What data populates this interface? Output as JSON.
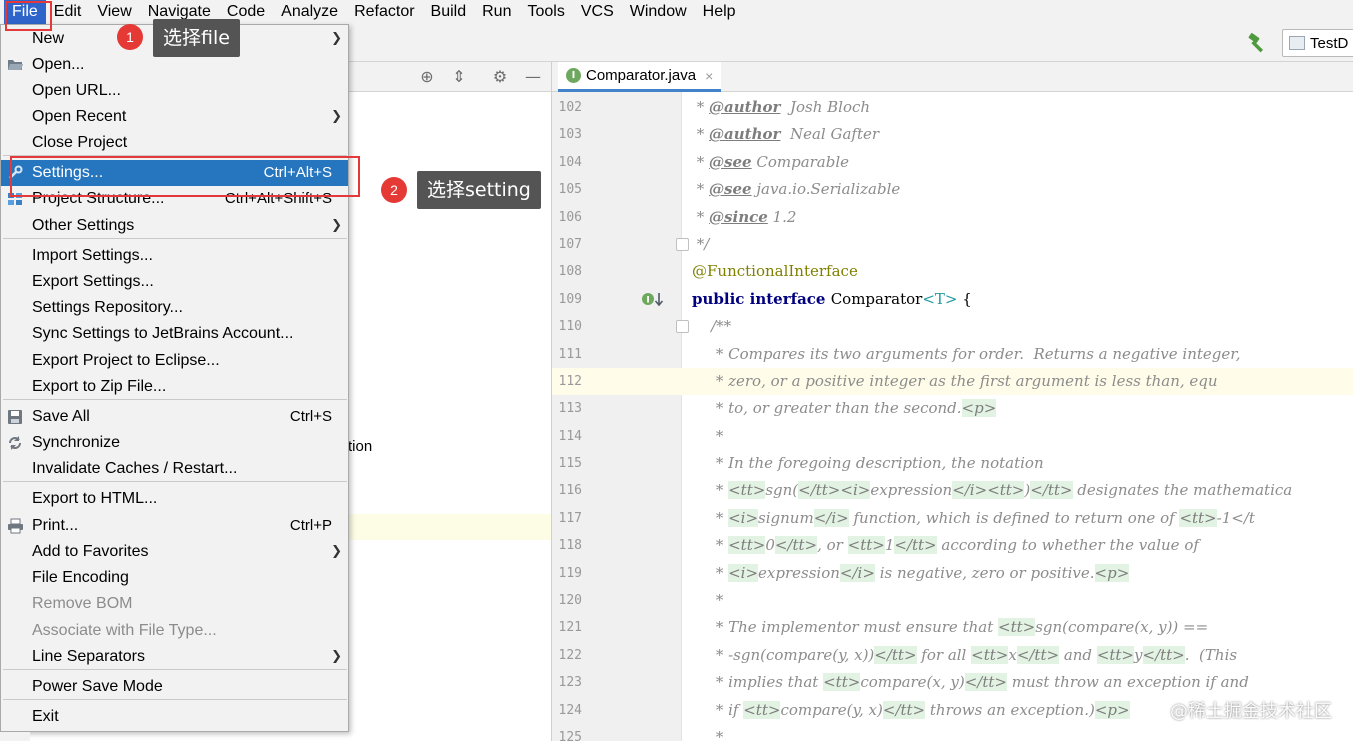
{
  "menubar": {
    "items": [
      "File",
      "Edit",
      "View",
      "Navigate",
      "Code",
      "Analyze",
      "Refactor",
      "Build",
      "Run",
      "Tools",
      "VCS",
      "Window",
      "Help"
    ]
  },
  "toolbar": {
    "run_config_label": "TestD"
  },
  "project_panel": {
    "partial_text": "tion"
  },
  "editor": {
    "tab_label": "Comparator.java",
    "tab_close": "×"
  },
  "file_menu": {
    "items": [
      {
        "label": "New",
        "shortcut": "",
        "submenu": true,
        "disabled": false
      },
      {
        "label": "Open...",
        "shortcut": "",
        "submenu": false,
        "disabled": false,
        "icon": "folder-open-icon"
      },
      {
        "label": "Open URL...",
        "shortcut": "",
        "submenu": false,
        "disabled": false
      },
      {
        "label": "Open Recent",
        "shortcut": "",
        "submenu": true,
        "disabled": false
      },
      {
        "label": "Close Project",
        "shortcut": "",
        "submenu": false,
        "disabled": false
      },
      {
        "label": "Settings...",
        "shortcut": "Ctrl+Alt+S",
        "submenu": false,
        "disabled": false,
        "selected": true,
        "icon": "wrench-icon"
      },
      {
        "label": "Project Structure...",
        "shortcut": "Ctrl+Alt+Shift+S",
        "submenu": false,
        "disabled": false,
        "icon": "project-structure-icon"
      },
      {
        "label": "Other Settings",
        "shortcut": "",
        "submenu": true,
        "disabled": false
      },
      {
        "label": "Import Settings...",
        "shortcut": "",
        "submenu": false,
        "disabled": false
      },
      {
        "label": "Export Settings...",
        "shortcut": "",
        "submenu": false,
        "disabled": false
      },
      {
        "label": "Settings Repository...",
        "shortcut": "",
        "submenu": false,
        "disabled": false
      },
      {
        "label": "Sync Settings to JetBrains Account...",
        "shortcut": "",
        "submenu": false,
        "disabled": false
      },
      {
        "label": "Export Project to Eclipse...",
        "shortcut": "",
        "submenu": false,
        "disabled": false
      },
      {
        "label": "Export to Zip File...",
        "shortcut": "",
        "submenu": false,
        "disabled": false
      },
      {
        "label": "Save All",
        "shortcut": "Ctrl+S",
        "submenu": false,
        "disabled": false,
        "icon": "save-icon"
      },
      {
        "label": "Synchronize",
        "shortcut": "",
        "submenu": false,
        "disabled": false,
        "icon": "sync-icon"
      },
      {
        "label": "Invalidate Caches / Restart...",
        "shortcut": "",
        "submenu": false,
        "disabled": false
      },
      {
        "label": "Export to HTML...",
        "shortcut": "",
        "submenu": false,
        "disabled": false
      },
      {
        "label": "Print...",
        "shortcut": "Ctrl+P",
        "submenu": false,
        "disabled": false,
        "icon": "print-icon"
      },
      {
        "label": "Add to Favorites",
        "shortcut": "",
        "submenu": true,
        "disabled": false
      },
      {
        "label": "File Encoding",
        "shortcut": "",
        "submenu": false,
        "disabled": false
      },
      {
        "label": "Remove BOM",
        "shortcut": "",
        "submenu": false,
        "disabled": true
      },
      {
        "label": "Associate with File Type...",
        "shortcut": "",
        "submenu": false,
        "disabled": true
      },
      {
        "label": "Line Separators",
        "shortcut": "",
        "submenu": true,
        "disabled": false
      },
      {
        "label": "Power Save Mode",
        "shortcut": "",
        "submenu": false,
        "disabled": false
      },
      {
        "label": "Exit",
        "shortcut": "",
        "submenu": false,
        "disabled": false
      }
    ]
  },
  "code_lines": [
    {
      "n": "102",
      "text": " * @author  Josh Bloch"
    },
    {
      "n": "103",
      "text": " * @author  Neal Gafter"
    },
    {
      "n": "104",
      "text": " * @see Comparable"
    },
    {
      "n": "105",
      "text": " * @see java.io.Serializable"
    },
    {
      "n": "106",
      "text": " * @since 1.2"
    },
    {
      "n": "107",
      "text": " */"
    },
    {
      "n": "108",
      "text": "@FunctionalInterface"
    },
    {
      "n": "109",
      "text": "public interface Comparator<T> {"
    },
    {
      "n": "110",
      "text": "    /**"
    },
    {
      "n": "111",
      "text": "     * Compares its two arguments for order.  Returns a negative integer,"
    },
    {
      "n": "112",
      "text": "     * zero, or a positive integer as the first argument is less than, equ"
    },
    {
      "n": "113",
      "text": "     * to, or greater than the second.<p>"
    },
    {
      "n": "114",
      "text": "     *"
    },
    {
      "n": "115",
      "text": "     * In the foregoing description, the notation"
    },
    {
      "n": "116",
      "text": "     * <tt>sgn(</tt><i>expression</i><tt>)</tt> designates the mathematica"
    },
    {
      "n": "117",
      "text": "     * <i>signum</i> function, which is defined to return one of <tt>-1</t"
    },
    {
      "n": "118",
      "text": "     * <tt>0</tt>, or <tt>1</tt> according to whether the value of"
    },
    {
      "n": "119",
      "text": "     * <i>expression</i> is negative, zero or positive.<p>"
    },
    {
      "n": "120",
      "text": "     *"
    },
    {
      "n": "121",
      "text": "     * The implementor must ensure that <tt>sgn(compare(x, y)) =="
    },
    {
      "n": "122",
      "text": "     * -sgn(compare(y, x))</tt> for all <tt>x</tt> and <tt>y</tt>.  (This"
    },
    {
      "n": "123",
      "text": "     * implies that <tt>compare(x, y)</tt> must throw an exception if and"
    },
    {
      "n": "124",
      "text": "     * if <tt>compare(y, x)</tt> throws an exception.)<p>"
    },
    {
      "n": "125",
      "text": "     *"
    }
  ],
  "annotations": {
    "step1_number": "1",
    "step1_text": "选择file",
    "step2_number": "2",
    "step2_text": "选择setting"
  },
  "watermark": "@稀土掘金技术社区",
  "colors": {
    "menu_selected": "#2675bf",
    "menubar_active": "#2f65ca",
    "annotation_red": "#e53935",
    "callout_bg": "#545454"
  }
}
